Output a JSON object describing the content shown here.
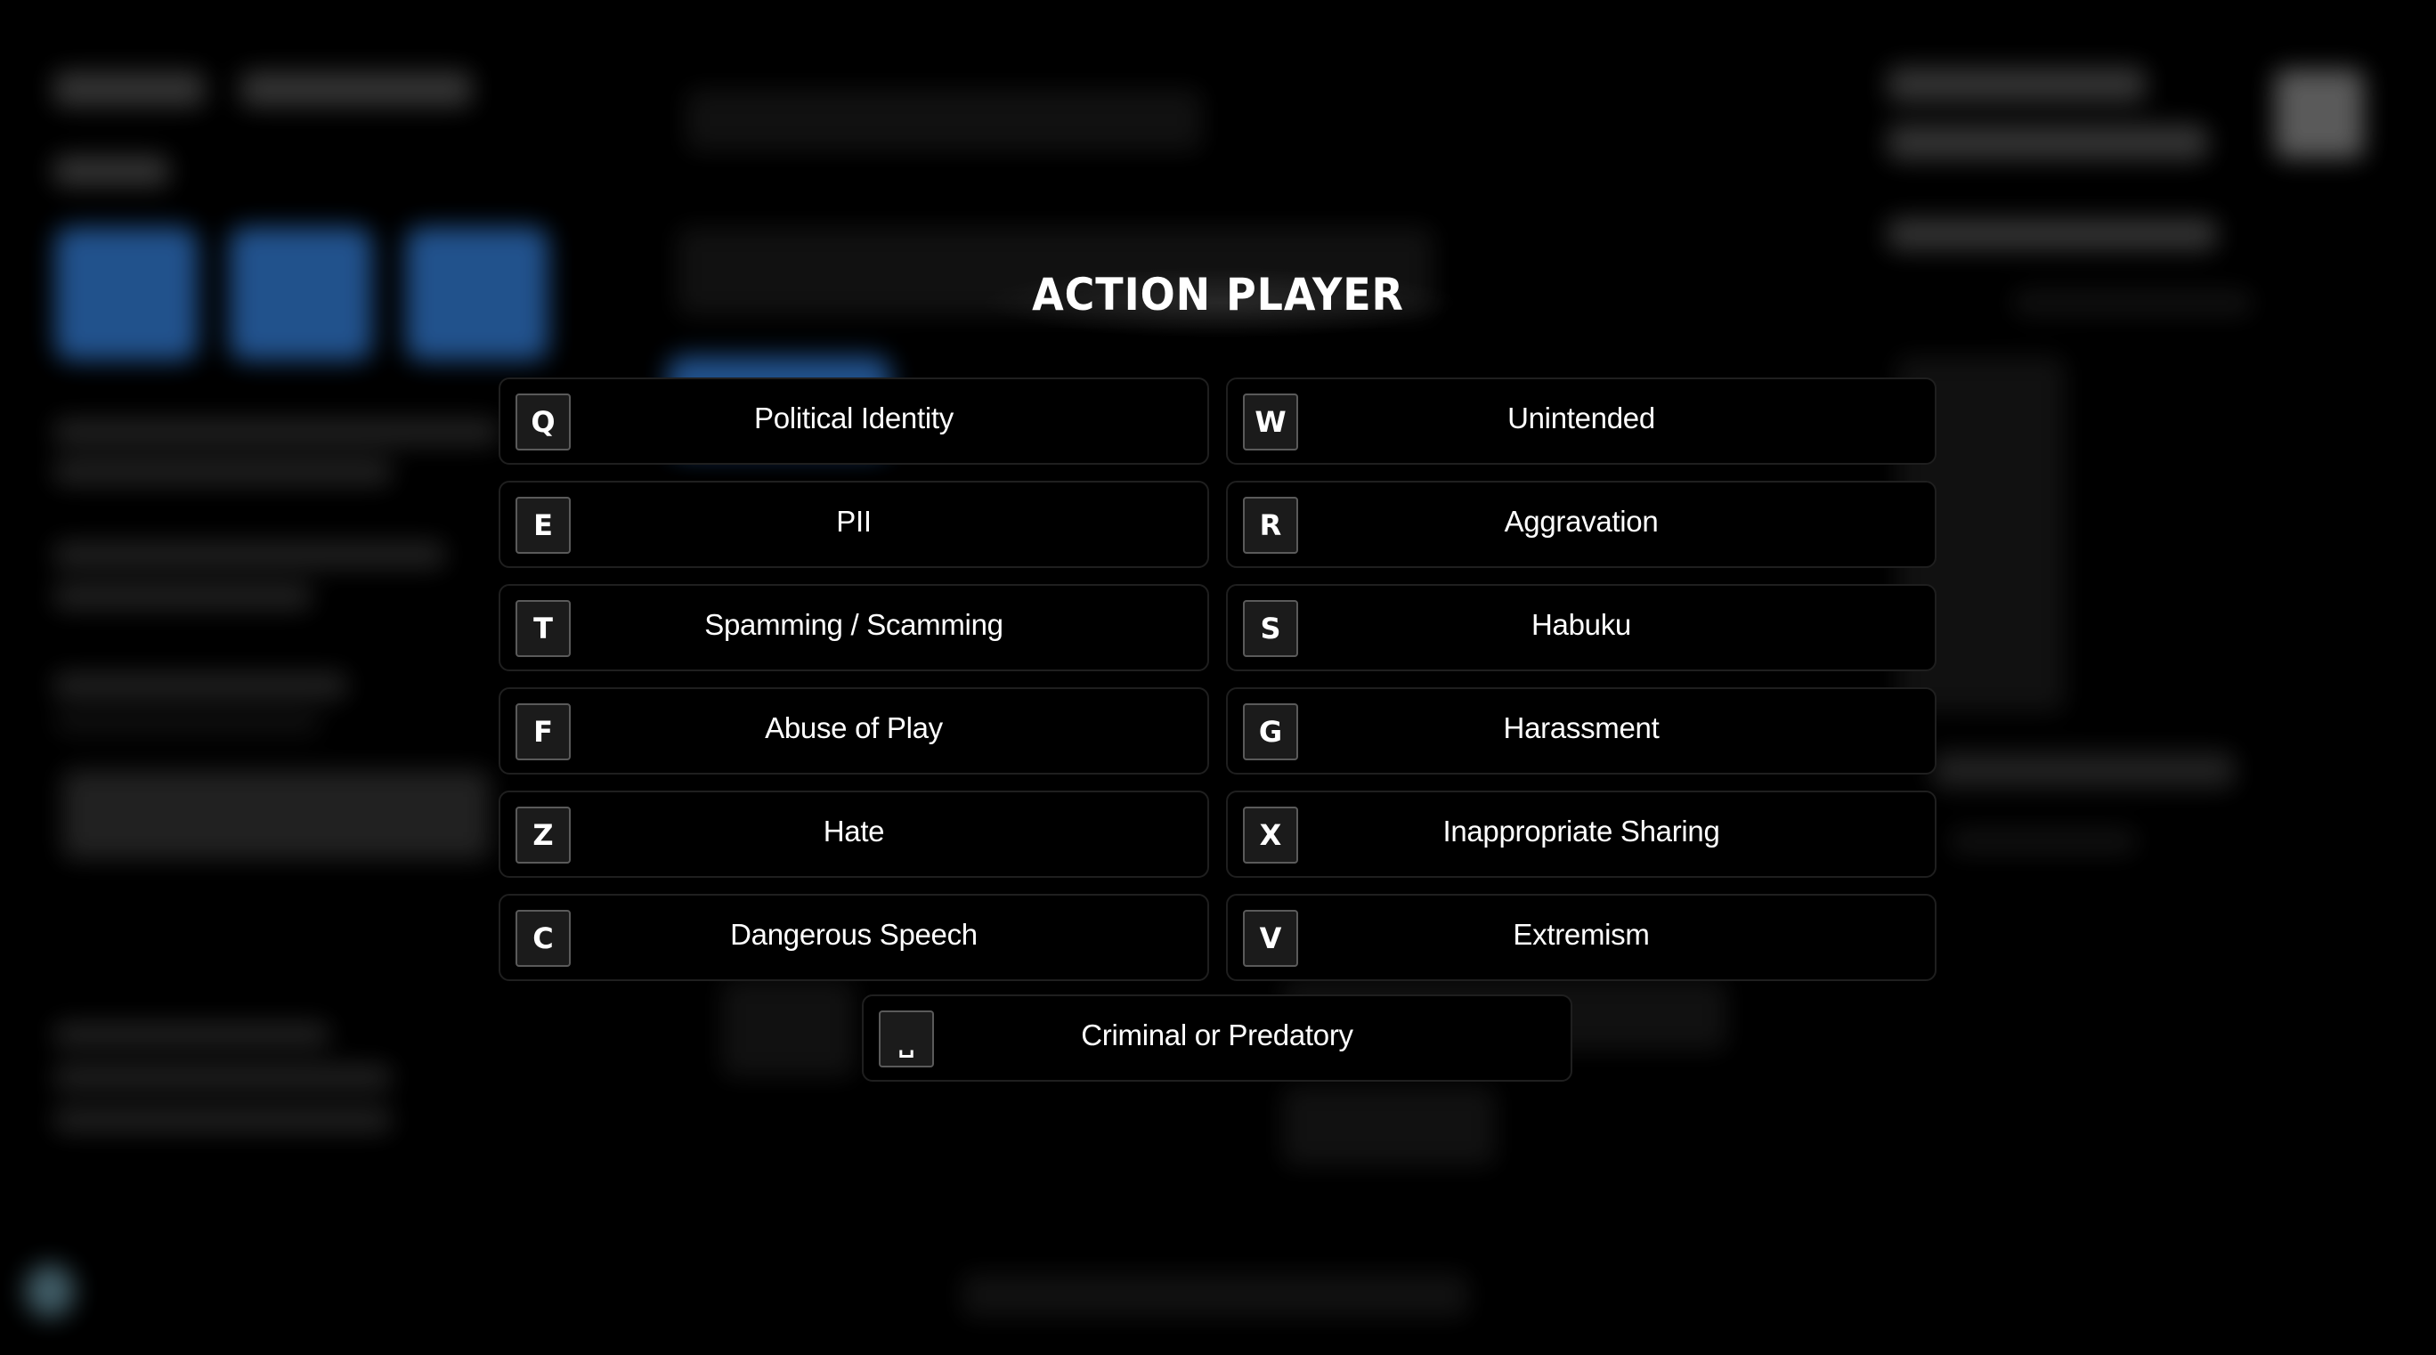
{
  "modal": {
    "title": "ACTION PLAYER",
    "actions": [
      {
        "key": "Q",
        "label": "Political Identity"
      },
      {
        "key": "W",
        "label": "Unintended"
      },
      {
        "key": "E",
        "label": "PII"
      },
      {
        "key": "R",
        "label": "Aggravation"
      },
      {
        "key": "T",
        "label": "Spamming / Scamming"
      },
      {
        "key": "S",
        "label": "Habuku"
      },
      {
        "key": "F",
        "label": "Abuse of Play"
      },
      {
        "key": "G",
        "label": "Harassment"
      },
      {
        "key": "Z",
        "label": "Hate"
      },
      {
        "key": "X",
        "label": "Inappropriate Sharing"
      },
      {
        "key": "C",
        "label": "Dangerous Speech"
      },
      {
        "key": "V",
        "label": "Extremism"
      },
      {
        "key": "␣",
        "label": "Criminal or Predatory"
      }
    ]
  },
  "colors": {
    "background": "#000000",
    "button_border": "#1f1f1f",
    "keycap_bg": "#1b1b1b",
    "keycap_border": "#5a5a5a",
    "background_accent": "#3a8cf0"
  }
}
